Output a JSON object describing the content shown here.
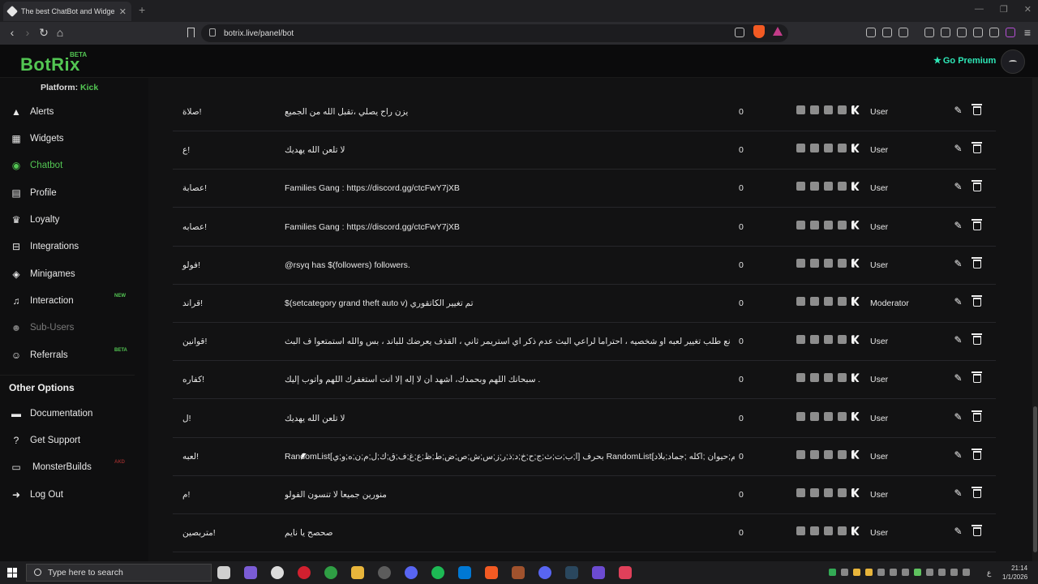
{
  "browser": {
    "tab_title": "The best ChatBot and Widgets fo",
    "new_tab": "+",
    "url": "botrix.live/panel/bot",
    "window_controls": [
      "—",
      "❐",
      "✕"
    ]
  },
  "header": {
    "logo": "BotRix",
    "logo_badge": "BETA",
    "premium_label": "Go Premium"
  },
  "sidebar": {
    "platform_label": "Platform:",
    "platform_value": "Kick",
    "items": [
      {
        "label": "Alerts",
        "icon": "warning-icon"
      },
      {
        "label": "Widgets",
        "icon": "grid-icon"
      },
      {
        "label": "Chatbot",
        "icon": "robot-icon",
        "active": true
      },
      {
        "label": "Profile",
        "icon": "id-card-icon"
      },
      {
        "label": "Loyalty",
        "icon": "trophy-icon"
      },
      {
        "label": "Integrations",
        "icon": "plug-icon"
      },
      {
        "label": "Minigames",
        "icon": "gamepad-icon"
      },
      {
        "label": "Interaction",
        "icon": "music-icon",
        "badge": "NEW"
      },
      {
        "label": "Sub-Users",
        "icon": "users-icon",
        "disabled": true
      },
      {
        "label": "Referrals",
        "icon": "people-icon",
        "badge": "BETA"
      }
    ],
    "other_options_title": "Other Options",
    "other_items": [
      {
        "label": "Documentation",
        "icon": "book-icon"
      },
      {
        "label": "Get Support",
        "icon": "help-icon"
      },
      {
        "label": "MonsterBuilds",
        "icon": "monitor-icon",
        "badge": "AKD"
      },
      {
        "label": "Log Out",
        "icon": "logout-icon"
      }
    ]
  },
  "commands": [
    {
      "cmd": "!صلاة",
      "response": "يزن راح يصلي ،تقبل الله من الجميع",
      "count": "0",
      "perm": "User"
    },
    {
      "cmd": "!ع",
      "response": "لا تلعن الله يهديك",
      "count": "0",
      "perm": "User"
    },
    {
      "cmd": "!عصابة",
      "response": "Families Gang : https://discord.gg/ctcFwY7jXB",
      "count": "0",
      "perm": "User"
    },
    {
      "cmd": "!عصابه",
      "response": "Families Gang : https://discord.gg/ctcFwY7jXB",
      "count": "0",
      "perm": "User"
    },
    {
      "cmd": "!فولو",
      "response": "@rsyq has $(followers) followers.",
      "count": "0",
      "perm": "User"
    },
    {
      "cmd": "!قراند",
      "response": "$(setcategory grand theft auto v) تم تغيير الكاتقوري",
      "count": "0",
      "perm": "Moderator"
    },
    {
      "cmd": "!قوانين",
      "response": "نع طلب تغيير لعبه او شخصيه ، احتراماً لراعي البث عدم ذكر اي استريمر ثاني ، القذف يعرضك للباند ، بس والله استمتعوا ف البث",
      "count": "0",
      "perm": "User"
    },
    {
      "cmd": "!كفاره",
      "response": "سبحانك اللهم وبحمدك، أشهد أن لا إله إلا أنت أستغفرك اللهم وأتوب إليك .",
      "count": "0",
      "perm": "User"
    },
    {
      "cmd": "!ل",
      "response": "لا تلعن الله يهديك",
      "count": "0",
      "perm": "User"
    },
    {
      "cmd": "!لعبه",
      "response": "RandomList[ا;ب;ت;ث;ج;ح;خ;د;ذ;ر;ز;س;ش;ص;ض;ط;ظ;ع;غ;ف;ق;ك;ل;م;ن;ه;و;ي] بحرف RandomList[اسم;حيوان ;اكله ;جماد;بلاد]",
      "count": "0",
      "perm": "User"
    },
    {
      "cmd": "!م",
      "response": "منورين جميعاً لا تنسون الفولو",
      "count": "0",
      "perm": "User"
    },
    {
      "cmd": "!متربصين",
      "response": "صحصح يا نايم",
      "count": "0",
      "perm": "User"
    }
  ],
  "row_icons": [
    "twitch-icon",
    "chat-icon",
    "youtube-icon",
    "trovo-icon",
    "kick-icon"
  ],
  "taskbar": {
    "search_placeholder": "Type here to search",
    "time": "21:14",
    "date": "1/1/2026",
    "lang": "ع"
  }
}
